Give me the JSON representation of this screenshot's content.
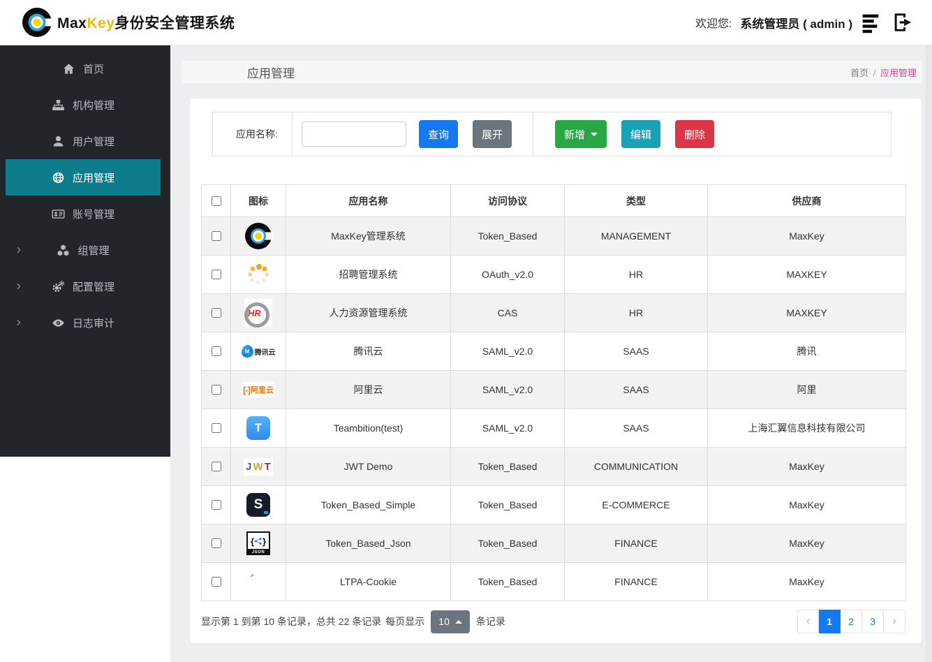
{
  "header": {
    "brand_max": "Max",
    "brand_key": "Key",
    "brand_cn": "身份安全管理系统",
    "welcome_label": "欢迎您:",
    "user": "系统管理员 ( admin )"
  },
  "sidebar": {
    "items": [
      {
        "label": "首页",
        "icon": "home-icon",
        "active": false,
        "expandable": false
      },
      {
        "label": "机构管理",
        "icon": "sitemap-icon",
        "active": false,
        "expandable": false
      },
      {
        "label": "用户管理",
        "icon": "user-icon",
        "active": false,
        "expandable": false
      },
      {
        "label": "应用管理",
        "icon": "globe-icon",
        "active": true,
        "expandable": false
      },
      {
        "label": "账号管理",
        "icon": "id-card-icon",
        "active": false,
        "expandable": false
      },
      {
        "label": "组管理",
        "icon": "cubes-icon",
        "active": false,
        "expandable": true
      },
      {
        "label": "配置管理",
        "icon": "gears-icon",
        "active": false,
        "expandable": true
      },
      {
        "label": "日志审计",
        "icon": "eye-icon",
        "active": false,
        "expandable": true
      }
    ]
  },
  "page": {
    "title": "应用管理",
    "breadcrumb": {
      "home": "首页",
      "sep": "/",
      "current": "应用管理"
    }
  },
  "toolbar": {
    "search_label": "应用名称:",
    "search_value": "",
    "query_label": "查询",
    "expand_label": "展开",
    "add_label": "新增",
    "edit_label": "编辑",
    "delete_label": "删除"
  },
  "table": {
    "headers": [
      "图标",
      "应用名称",
      "访问协议",
      "类型",
      "供应商"
    ],
    "rows": [
      {
        "icon": "maxkey-logo",
        "name": "MaxKey管理系统",
        "protocol": "Token_Based",
        "type": "MANAGEMENT",
        "vendor": "MaxKey"
      },
      {
        "icon": "dots-spinner",
        "name": "招聘管理系统",
        "protocol": "OAuth_v2.0",
        "type": "HR",
        "vendor": "MAXKEY"
      },
      {
        "icon": "hr-logo",
        "name": "人力资源管理系统",
        "protocol": "CAS",
        "type": "HR",
        "vendor": "MAXKEY"
      },
      {
        "icon": "tencent-cloud-logo",
        "name": "腾讯云",
        "protocol": "SAML_v2.0",
        "type": "SAAS",
        "vendor": "腾讯"
      },
      {
        "icon": "aliyun-logo",
        "name": "阿里云",
        "protocol": "SAML_v2.0",
        "type": "SAAS",
        "vendor": "阿里"
      },
      {
        "icon": "teambition-logo",
        "name": "Teambition(test)",
        "protocol": "SAML_v2.0",
        "type": "SAAS",
        "vendor": "上海汇翼信息科技有限公司"
      },
      {
        "icon": "jwt-logo",
        "name": "JWT Demo",
        "protocol": "Token_Based",
        "type": "COMMUNICATION",
        "vendor": "MaxKey"
      },
      {
        "icon": "s-logo",
        "name": "Token_Based_Simple",
        "protocol": "Token_Based",
        "type": "E-COMMERCE",
        "vendor": "MaxKey"
      },
      {
        "icon": "json-logo",
        "name": "Token_Based_Json",
        "protocol": "Token_Based",
        "type": "FINANCE",
        "vendor": "MaxKey"
      },
      {
        "icon": "ltpa-logo",
        "name": "LTPA-Cookie",
        "protocol": "Token_Based",
        "type": "FINANCE",
        "vendor": "MaxKey"
      }
    ]
  },
  "icons": {
    "tencent_m": "M",
    "tencent_text": "腾讯云",
    "aliyun_brackets": "[-]",
    "aliyun_text": "阿里云",
    "hr_text": "HR",
    "teambition_letter": "T",
    "jwt_j": "J",
    "jwt_w": "W",
    "jwt_t": "T",
    "s_letter": "S",
    "json_brace_open": "{",
    "json_brace_close": "}",
    "json_label": "JSON"
  },
  "pagination": {
    "summary_prefix": "显示第 1 到第 10 条记录，总共 22 条记录",
    "page_size_label": "每页显示",
    "page_size": "10",
    "summary_suffix": "条记录",
    "prev": "‹",
    "next": "›",
    "pages": [
      "1",
      "2",
      "3"
    ],
    "active_page": "1"
  },
  "colors": {
    "primary_blue": "#157af2",
    "success_green": "#28a745",
    "info_teal": "#17a2b8",
    "danger_red": "#dc3545",
    "secondary_gray": "#6c757d",
    "sidebar_bg": "#22262b",
    "sidebar_active_teal": "#0d7d8c",
    "breadcrumb_pink": "#e8388c",
    "brand_yellow": "#f5b800"
  }
}
